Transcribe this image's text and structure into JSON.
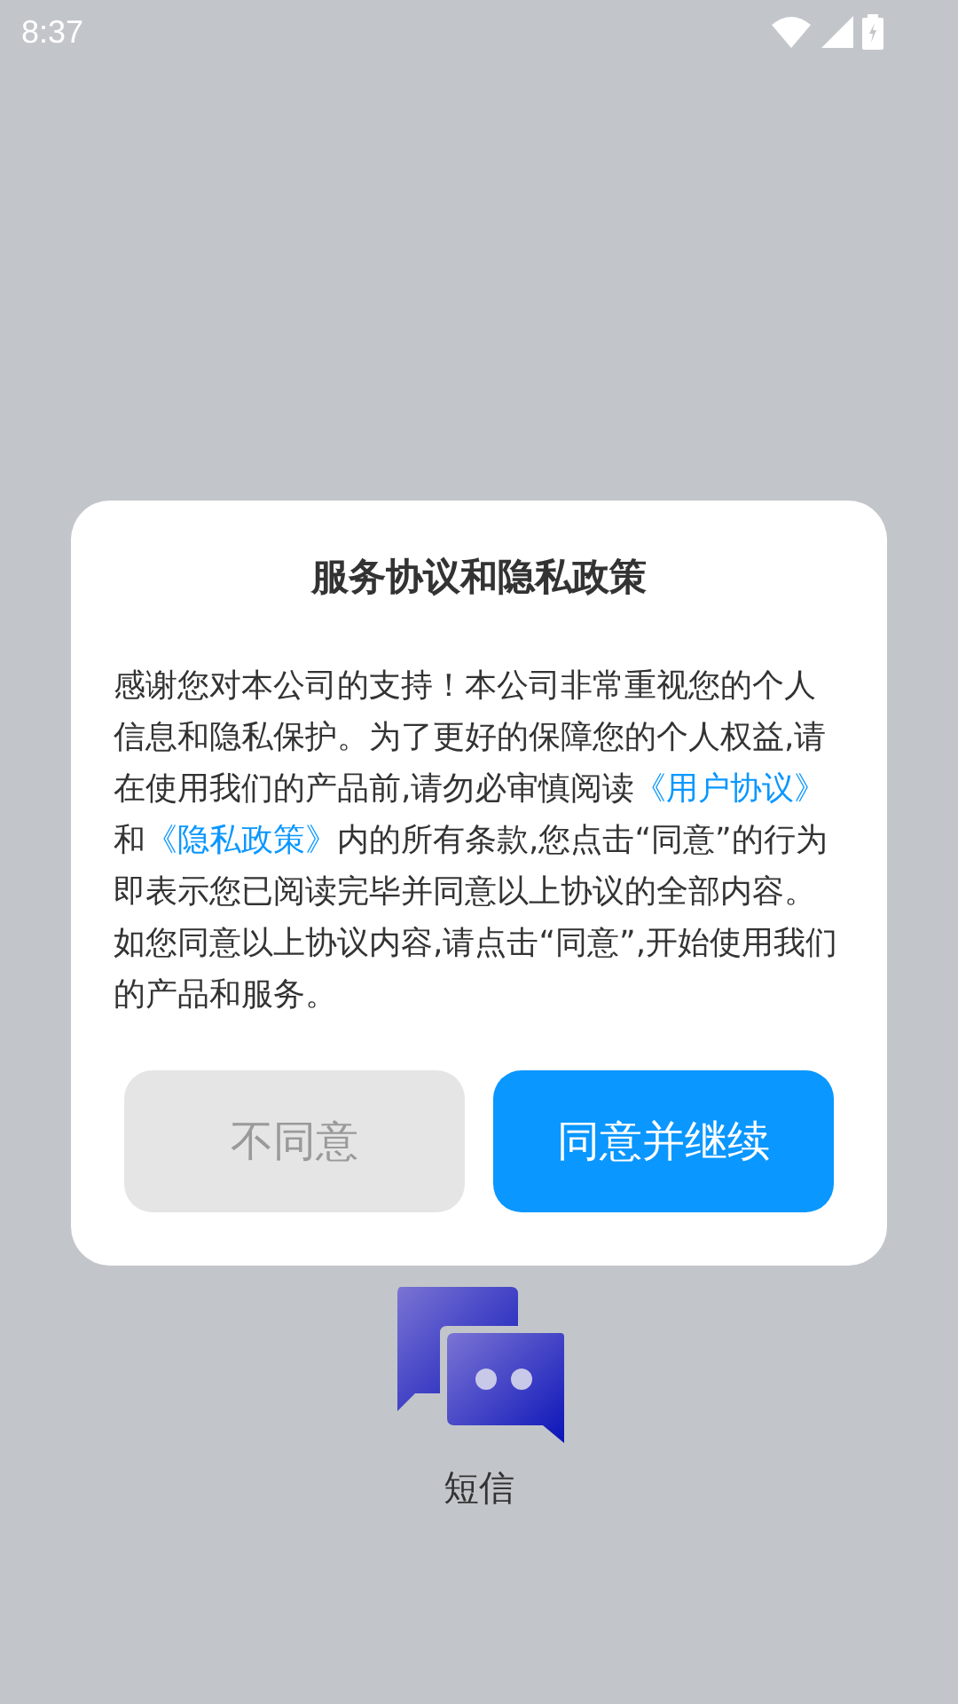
{
  "status_bar": {
    "time": "8:37"
  },
  "app": {
    "label": "短信"
  },
  "dialog": {
    "title": "服务协议和隐私政策",
    "body": [
      {
        "kind": "text",
        "text": "感谢您对本公司的支持！本公司非常重视您的个人信息和隐私保护。为了更好的保障您的个人权益,请在使用我们的产品前,请勿必审慎阅读"
      },
      {
        "kind": "link",
        "text": "《用户协议》"
      },
      {
        "kind": "text",
        "text": "和"
      },
      {
        "kind": "link",
        "text": "《隐私政策》"
      },
      {
        "kind": "text",
        "text": "内的所有条款,您点击“同意”的行为即表示您已阅读完毕并同意以上协议的全部内容。如您同意以上协议内容,请点击“同意”,开始使用我们的产品和服务。"
      }
    ],
    "buttons": [
      {
        "kind": "decline",
        "label": "不同意"
      },
      {
        "kind": "accept",
        "label": "同意并继续"
      }
    ]
  }
}
